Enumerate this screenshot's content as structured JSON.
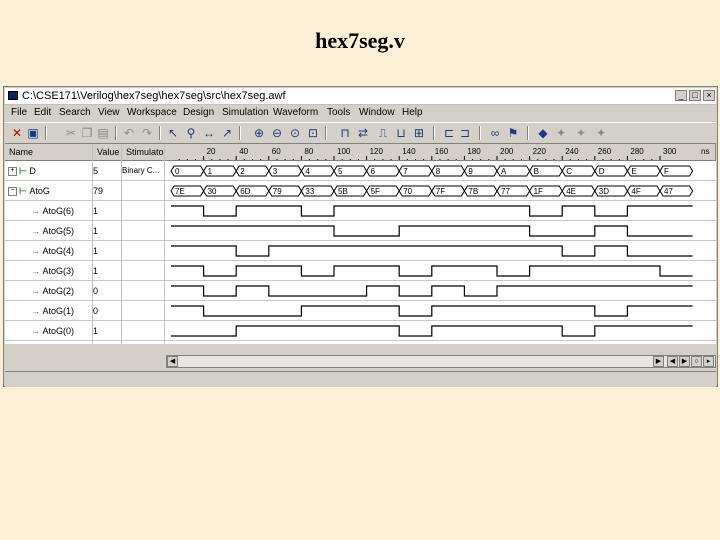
{
  "slide": {
    "title": "hex7seg.v"
  },
  "window": {
    "title": "C:\\CSE171\\Verilog\\hex7seg\\hex7seg\\src\\hex7seg.awf",
    "min": "_",
    "max": "□",
    "close": "×"
  },
  "menu": [
    "File",
    "Edit",
    "Search",
    "View",
    "Workspace",
    "Design",
    "Simulation",
    "Waveform",
    "Tools",
    "Window",
    "Help"
  ],
  "toolbar_icons": [
    "x-icon",
    "save-icon",
    "cut-icon",
    "copy-icon",
    "paste-icon",
    "undo-icon",
    "redo-icon",
    "pointer-icon",
    "zoom-icon",
    "ruler-icon",
    "pointer-edit-icon",
    "zoom-in-icon",
    "zoom-out-icon",
    "zoom-fit-icon",
    "zoom-range-icon",
    "waveform-icon",
    "search-next-icon",
    "event-icon",
    "clock-icon",
    "binoculars-icon",
    "find-icon",
    "stimulus-icon",
    "breakpoint-icon",
    "run-icon",
    "stop-icon"
  ],
  "columns": {
    "name": "Name",
    "value": "Value",
    "stimulator": "Stimulator"
  },
  "timescale": [
    "20",
    "40",
    "60",
    "80",
    "100",
    "120",
    "140",
    "160",
    "180",
    "200",
    "220",
    "240",
    "260",
    "280",
    "300"
  ],
  "timescale_end": "ns",
  "signals": [
    {
      "name": "D",
      "value": "5",
      "stim": "Binary C...",
      "expander": "+",
      "bus": true
    },
    {
      "name": "AtoG",
      "value": "79",
      "stim": "",
      "expander": "−",
      "bus": true
    },
    {
      "name": "AtoG(6)",
      "value": "1"
    },
    {
      "name": "AtoG(5)",
      "value": "1"
    },
    {
      "name": "AtoG(4)",
      "value": "1"
    },
    {
      "name": "AtoG(3)",
      "value": "1"
    },
    {
      "name": "AtoG(2)",
      "value": "0"
    },
    {
      "name": "AtoG(1)",
      "value": "0"
    },
    {
      "name": "AtoG(0)",
      "value": "1"
    }
  ],
  "d_bus": [
    "0",
    "1",
    "2",
    "3",
    "4",
    "5",
    "6",
    "7",
    "8",
    "9",
    "A",
    "B",
    "C",
    "D",
    "E",
    "F"
  ],
  "atog_bus": [
    "7E",
    "30",
    "6D",
    "79",
    "33",
    "5B",
    "5F",
    "70",
    "7F",
    "7B",
    "77",
    "1F",
    "4E",
    "3D",
    "4F",
    "47"
  ],
  "bits": [
    [
      1,
      0,
      1,
      1,
      0,
      1,
      1,
      1,
      1,
      1,
      1,
      0,
      1,
      0,
      1,
      1
    ],
    [
      1,
      1,
      1,
      1,
      1,
      0,
      0,
      1,
      1,
      1,
      1,
      0,
      0,
      1,
      0,
      0
    ],
    [
      1,
      1,
      0,
      1,
      1,
      1,
      1,
      1,
      1,
      1,
      1,
      1,
      0,
      1,
      0,
      0
    ],
    [
      1,
      0,
      1,
      1,
      0,
      1,
      1,
      0,
      1,
      1,
      0,
      1,
      1,
      1,
      1,
      0
    ],
    [
      1,
      0,
      1,
      0,
      0,
      0,
      1,
      0,
      1,
      0,
      1,
      1,
      1,
      1,
      1,
      1
    ],
    [
      1,
      0,
      0,
      0,
      1,
      1,
      1,
      0,
      1,
      1,
      1,
      1,
      1,
      0,
      1,
      1
    ],
    [
      0,
      0,
      1,
      1,
      1,
      1,
      1,
      0,
      1,
      1,
      1,
      1,
      0,
      1,
      1,
      1
    ]
  ]
}
